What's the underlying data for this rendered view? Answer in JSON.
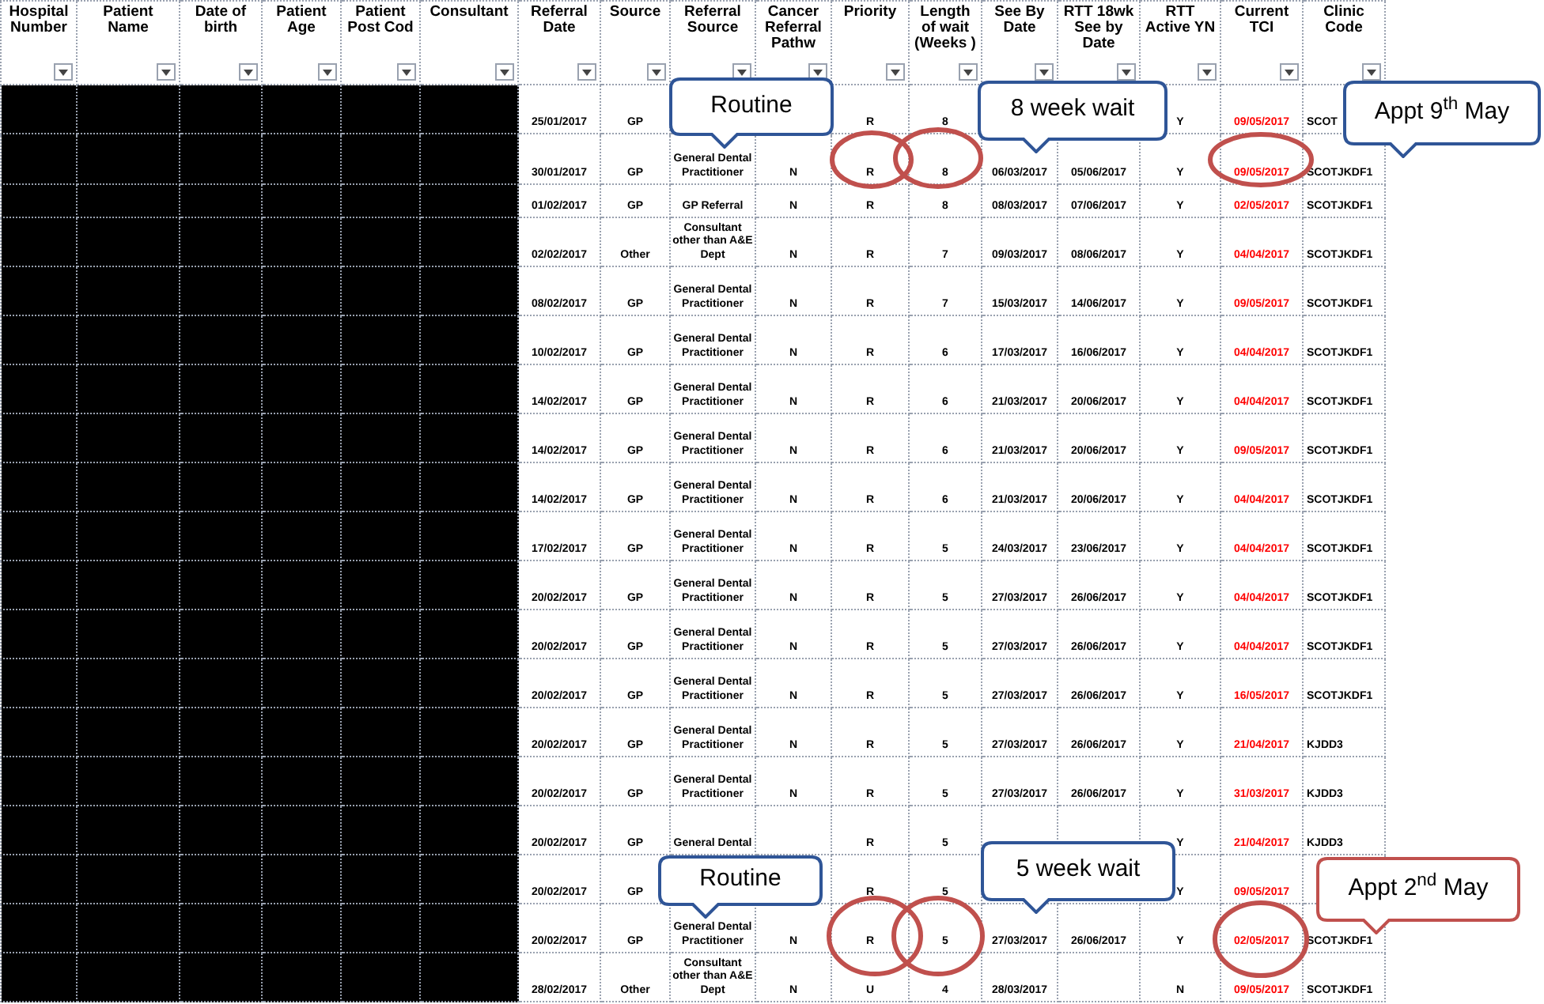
{
  "columns": [
    {
      "label": "Hospital Number",
      "kind": "redacted"
    },
    {
      "label": "Patient Name",
      "kind": "redacted"
    },
    {
      "label": "Date of birth",
      "kind": "redacted"
    },
    {
      "label": "Patient Age",
      "kind": "redacted"
    },
    {
      "label": "Patient Post Cod",
      "kind": "redacted"
    },
    {
      "label": "Consultant",
      "kind": "redacted"
    },
    {
      "label": "Referral Date",
      "kind": "text"
    },
    {
      "label": "Source",
      "kind": "text"
    },
    {
      "label": "Referral Source",
      "kind": "text"
    },
    {
      "label": "Cancer Referral Pathw",
      "kind": "text"
    },
    {
      "label": "Priority",
      "kind": "text"
    },
    {
      "label": "Length of wait (Weeks )",
      "kind": "text"
    },
    {
      "label": "See By Date",
      "kind": "text"
    },
    {
      "label": "RTT 18wk See by Date",
      "kind": "text"
    },
    {
      "label": "RTT Active YN",
      "kind": "text"
    },
    {
      "label": "Current TCI",
      "kind": "alert"
    },
    {
      "label": "Clinic Code",
      "kind": "code"
    }
  ],
  "rows": [
    {
      "referral_date": "25/01/2017",
      "source": "GP",
      "priority": "R",
      "length_of_wait": "8",
      "rtt_active": "Y",
      "current_tci": "09/05/2017",
      "clinic_code": "SCOT"
    },
    {
      "referral_date": "30/01/2017",
      "source": "GP",
      "referral_source": "General Dental Practitioner",
      "cancer_pathway": "N",
      "priority": "R",
      "length_of_wait": "8",
      "see_by_date": "06/03/2017",
      "rtt_see_by_date": "05/06/2017",
      "rtt_active": "Y",
      "current_tci": "09/05/2017",
      "clinic_code": "SCOTJKDF1"
    },
    {
      "referral_date": "01/02/2017",
      "source": "GP",
      "referral_source": "GP Referral",
      "cancer_pathway": "N",
      "priority": "R",
      "length_of_wait": "8",
      "see_by_date": "08/03/2017",
      "rtt_see_by_date": "07/06/2017",
      "rtt_active": "Y",
      "current_tci": "02/05/2017",
      "clinic_code": "SCOTJKDF1"
    },
    {
      "referral_date": "02/02/2017",
      "source": "Other",
      "referral_source": "Consultant other than A&E Dept",
      "cancer_pathway": "N",
      "priority": "R",
      "length_of_wait": "7",
      "see_by_date": "09/03/2017",
      "rtt_see_by_date": "08/06/2017",
      "rtt_active": "Y",
      "current_tci": "04/04/2017",
      "clinic_code": "SCOTJKDF1"
    },
    {
      "referral_date": "08/02/2017",
      "source": "GP",
      "referral_source": "General Dental Practitioner",
      "cancer_pathway": "N",
      "priority": "R",
      "length_of_wait": "7",
      "see_by_date": "15/03/2017",
      "rtt_see_by_date": "14/06/2017",
      "rtt_active": "Y",
      "current_tci": "09/05/2017",
      "clinic_code": "SCOTJKDF1"
    },
    {
      "referral_date": "10/02/2017",
      "source": "GP",
      "referral_source": "General Dental Practitioner",
      "cancer_pathway": "N",
      "priority": "R",
      "length_of_wait": "6",
      "see_by_date": "17/03/2017",
      "rtt_see_by_date": "16/06/2017",
      "rtt_active": "Y",
      "current_tci": "04/04/2017",
      "clinic_code": "SCOTJKDF1"
    },
    {
      "referral_date": "14/02/2017",
      "source": "GP",
      "referral_source": "General Dental Practitioner",
      "cancer_pathway": "N",
      "priority": "R",
      "length_of_wait": "6",
      "see_by_date": "21/03/2017",
      "rtt_see_by_date": "20/06/2017",
      "rtt_active": "Y",
      "current_tci": "04/04/2017",
      "clinic_code": "SCOTJKDF1"
    },
    {
      "referral_date": "14/02/2017",
      "source": "GP",
      "referral_source": "General Dental Practitioner",
      "cancer_pathway": "N",
      "priority": "R",
      "length_of_wait": "6",
      "see_by_date": "21/03/2017",
      "rtt_see_by_date": "20/06/2017",
      "rtt_active": "Y",
      "current_tci": "09/05/2017",
      "clinic_code": "SCOTJKDF1"
    },
    {
      "referral_date": "14/02/2017",
      "source": "GP",
      "referral_source": "General Dental Practitioner",
      "cancer_pathway": "N",
      "priority": "R",
      "length_of_wait": "6",
      "see_by_date": "21/03/2017",
      "rtt_see_by_date": "20/06/2017",
      "rtt_active": "Y",
      "current_tci": "04/04/2017",
      "clinic_code": "SCOTJKDF1"
    },
    {
      "referral_date": "17/02/2017",
      "source": "GP",
      "referral_source": "General Dental Practitioner",
      "cancer_pathway": "N",
      "priority": "R",
      "length_of_wait": "5",
      "see_by_date": "24/03/2017",
      "rtt_see_by_date": "23/06/2017",
      "rtt_active": "Y",
      "current_tci": "04/04/2017",
      "clinic_code": "SCOTJKDF1"
    },
    {
      "referral_date": "20/02/2017",
      "source": "GP",
      "referral_source": "General Dental Practitioner",
      "cancer_pathway": "N",
      "priority": "R",
      "length_of_wait": "5",
      "see_by_date": "27/03/2017",
      "rtt_see_by_date": "26/06/2017",
      "rtt_active": "Y",
      "current_tci": "04/04/2017",
      "clinic_code": "SCOTJKDF1"
    },
    {
      "referral_date": "20/02/2017",
      "source": "GP",
      "referral_source": "General Dental Practitioner",
      "cancer_pathway": "N",
      "priority": "R",
      "length_of_wait": "5",
      "see_by_date": "27/03/2017",
      "rtt_see_by_date": "26/06/2017",
      "rtt_active": "Y",
      "current_tci": "04/04/2017",
      "clinic_code": "SCOTJKDF1"
    },
    {
      "referral_date": "20/02/2017",
      "source": "GP",
      "referral_source": "General Dental Practitioner",
      "cancer_pathway": "N",
      "priority": "R",
      "length_of_wait": "5",
      "see_by_date": "27/03/2017",
      "rtt_see_by_date": "26/06/2017",
      "rtt_active": "Y",
      "current_tci": "16/05/2017",
      "clinic_code": "SCOTJKDF1"
    },
    {
      "referral_date": "20/02/2017",
      "source": "GP",
      "referral_source": "General Dental Practitioner",
      "cancer_pathway": "N",
      "priority": "R",
      "length_of_wait": "5",
      "see_by_date": "27/03/2017",
      "rtt_see_by_date": "26/06/2017",
      "rtt_active": "Y",
      "current_tci": "21/04/2017",
      "clinic_code": "KJDD3"
    },
    {
      "referral_date": "20/02/2017",
      "source": "GP",
      "referral_source": "General Dental Practitioner",
      "cancer_pathway": "N",
      "priority": "R",
      "length_of_wait": "5",
      "see_by_date": "27/03/2017",
      "rtt_see_by_date": "26/06/2017",
      "rtt_active": "Y",
      "current_tci": "31/03/2017",
      "clinic_code": "KJDD3"
    },
    {
      "referral_date": "20/02/2017",
      "source": "GP",
      "referral_source": "General Dental",
      "priority": "R",
      "length_of_wait": "5",
      "rtt_active": "Y",
      "current_tci": "21/04/2017",
      "clinic_code": "KJDD3"
    },
    {
      "referral_date": "20/02/2017",
      "source": "GP",
      "priority": "R",
      "length_of_wait": "5",
      "rtt_active": "Y",
      "current_tci": "09/05/2017"
    },
    {
      "referral_date": "20/02/2017",
      "source": "GP",
      "referral_source": "General Dental Practitioner",
      "cancer_pathway": "N",
      "priority": "R",
      "length_of_wait": "5",
      "see_by_date": "27/03/2017",
      "rtt_see_by_date": "26/06/2017",
      "rtt_active": "Y",
      "current_tci": "02/05/2017",
      "clinic_code": "SCOTJKDF1"
    },
    {
      "referral_date": "28/02/2017",
      "source": "Other",
      "referral_source": "Consultant other than A&E Dept",
      "cancer_pathway": "N",
      "priority": "U",
      "length_of_wait": "4",
      "see_by_date": "28/03/2017",
      "rtt_active": "N",
      "current_tci": "09/05/2017",
      "clinic_code": "SCOTJKDF1"
    }
  ],
  "callouts": [
    {
      "text": "Routine",
      "color": "#2f5597"
    },
    {
      "text": "8 week wait",
      "color": "#2f5597"
    },
    {
      "text": "Appt 9$^{th}$ May",
      "color": "#2f5597"
    },
    {
      "text": "Routine",
      "color": "#2f5597"
    },
    {
      "text": "5 week wait",
      "color": "#2f5597"
    },
    {
      "text": "Appt 2$^{nd}$ May",
      "color": "#c0504d"
    }
  ]
}
